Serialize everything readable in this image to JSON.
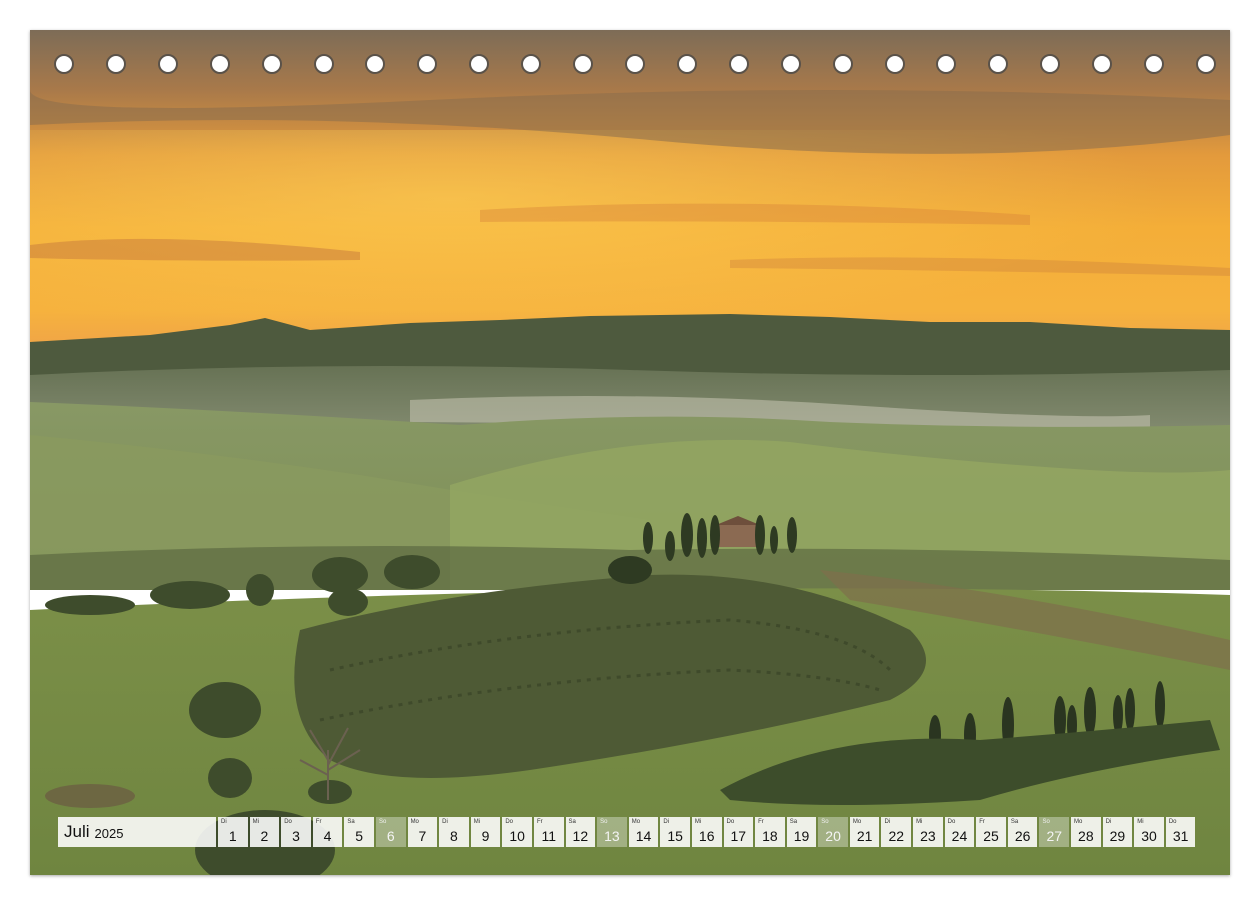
{
  "calendar": {
    "month": "Juli",
    "year": "2025",
    "days": [
      {
        "num": "1",
        "dow": "Di",
        "weekend": false
      },
      {
        "num": "2",
        "dow": "Mi",
        "weekend": false
      },
      {
        "num": "3",
        "dow": "Do",
        "weekend": false
      },
      {
        "num": "4",
        "dow": "Fr",
        "weekend": false
      },
      {
        "num": "5",
        "dow": "Sa",
        "weekend": false
      },
      {
        "num": "6",
        "dow": "So",
        "weekend": true
      },
      {
        "num": "7",
        "dow": "Mo",
        "weekend": false
      },
      {
        "num": "8",
        "dow": "Di",
        "weekend": false
      },
      {
        "num": "9",
        "dow": "Mi",
        "weekend": false
      },
      {
        "num": "10",
        "dow": "Do",
        "weekend": false
      },
      {
        "num": "11",
        "dow": "Fr",
        "weekend": false
      },
      {
        "num": "12",
        "dow": "Sa",
        "weekend": false
      },
      {
        "num": "13",
        "dow": "So",
        "weekend": true
      },
      {
        "num": "14",
        "dow": "Mo",
        "weekend": false
      },
      {
        "num": "15",
        "dow": "Di",
        "weekend": false
      },
      {
        "num": "16",
        "dow": "Mi",
        "weekend": false
      },
      {
        "num": "17",
        "dow": "Do",
        "weekend": false
      },
      {
        "num": "18",
        "dow": "Fr",
        "weekend": false
      },
      {
        "num": "19",
        "dow": "Sa",
        "weekend": false
      },
      {
        "num": "20",
        "dow": "So",
        "weekend": true
      },
      {
        "num": "21",
        "dow": "Mo",
        "weekend": false
      },
      {
        "num": "22",
        "dow": "Di",
        "weekend": false
      },
      {
        "num": "23",
        "dow": "Mi",
        "weekend": false
      },
      {
        "num": "24",
        "dow": "Do",
        "weekend": false
      },
      {
        "num": "25",
        "dow": "Fr",
        "weekend": false
      },
      {
        "num": "26",
        "dow": "Sa",
        "weekend": false
      },
      {
        "num": "27",
        "dow": "So",
        "weekend": true
      },
      {
        "num": "28",
        "dow": "Mo",
        "weekend": false
      },
      {
        "num": "29",
        "dow": "Di",
        "weekend": false
      },
      {
        "num": "30",
        "dow": "Mi",
        "weekend": false
      },
      {
        "num": "31",
        "dow": "Do",
        "weekend": false
      }
    ]
  },
  "binding": {
    "hole_count": 23
  }
}
